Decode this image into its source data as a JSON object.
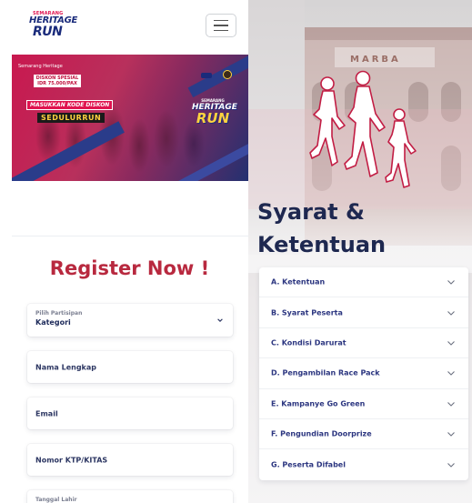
{
  "header": {
    "logo_top": "SEMARANG",
    "logo_mid": "HERITAGE",
    "logo_sub": "HALFMARATHON",
    "logo_bottom": "RUN",
    "menu_icon": "hamburger-icon"
  },
  "banner": {
    "sponsor": "Semarang Heritage",
    "promo": "DISKON SPESIAL IDR 75.000/PAX",
    "ticket": "MASUKKAN KODE DISKON",
    "code": "SEDULURRUN",
    "logo_top": "SEMARANG",
    "logo_mid": "HERITAGE",
    "logo_bottom": "RUN"
  },
  "register": {
    "title": "Register Now !",
    "fields": [
      {
        "label": "Pilih Partisipan",
        "value": "Kategori",
        "type": "select"
      },
      {
        "placeholder": "Nama Lengkap"
      },
      {
        "placeholder": "Email"
      },
      {
        "placeholder": "Nomor KTP/KITAS"
      },
      {
        "label": "Tanggal Lahir"
      }
    ]
  },
  "terms": {
    "building_sign": "MARBA",
    "title_line1": "Syarat &",
    "title_line2": "Ketentuan",
    "items": [
      {
        "label": "A. Ketentuan"
      },
      {
        "label": "B. Syarat Peserta"
      },
      {
        "label": "C. Kondisi Darurat"
      },
      {
        "label": "D. Pengambilan Race Pack"
      },
      {
        "label": "E. Kampanye Go Green"
      },
      {
        "label": "F. Pengundian Doorprize"
      },
      {
        "label": "G. Peserta Difabel"
      }
    ]
  },
  "colors": {
    "accent_red": "#b8293f",
    "navy": "#1e2850",
    "link_blue": "#2c3680"
  }
}
